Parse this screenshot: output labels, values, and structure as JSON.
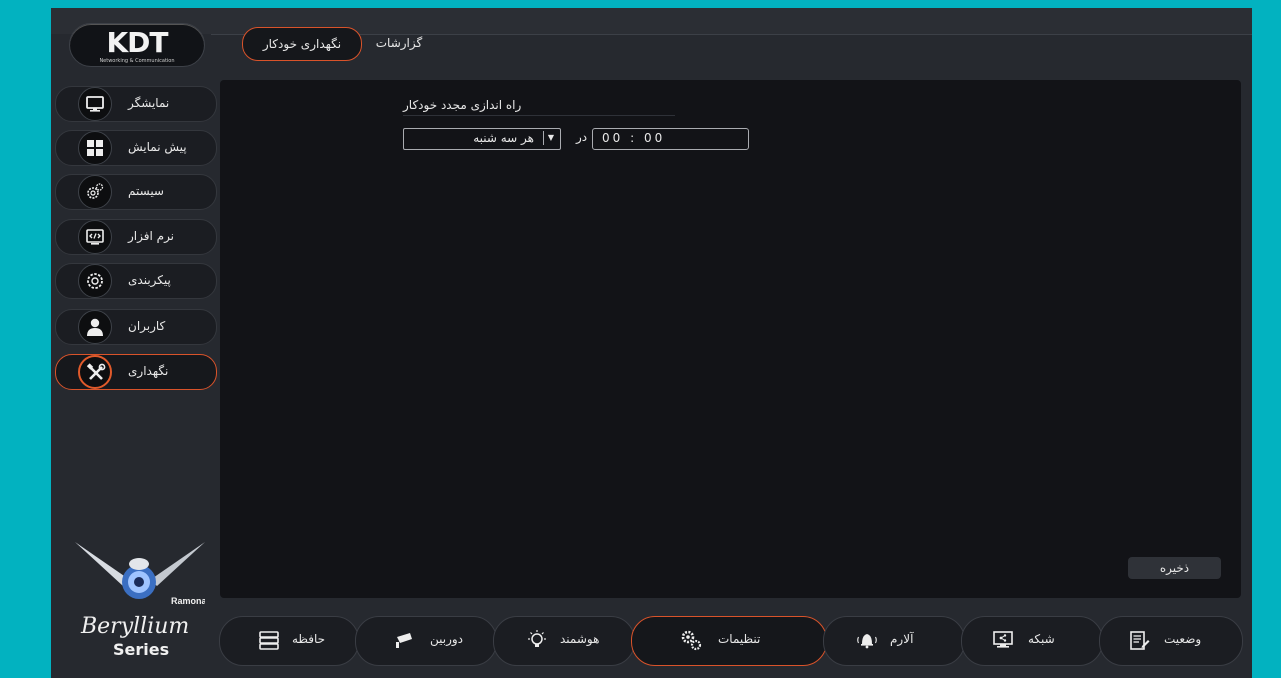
{
  "logo": {
    "mark": "KDT",
    "tagline": "Networking & Communication"
  },
  "top_tabs": {
    "active": "نگهداری خودکار",
    "reports": "گزارشات"
  },
  "sidebar": {
    "items": [
      {
        "label": "نمایشگر",
        "icon": "monitor-icon"
      },
      {
        "label": "پیش نمایش",
        "icon": "grid-icon"
      },
      {
        "label": "سیستم",
        "icon": "gears-icon"
      },
      {
        "label": "نرم افزار",
        "icon": "code-icon"
      },
      {
        "label": "پیکربندی",
        "icon": "config-gear-icon"
      },
      {
        "label": "کاربران",
        "icon": "user-icon"
      },
      {
        "label": "نگهداری",
        "icon": "tools-icon"
      }
    ],
    "active_index": 6
  },
  "main": {
    "section_title": "راه اندازی مجدد خودکار",
    "day_select": {
      "value": "هر سه شنبه"
    },
    "at_label": "در",
    "time_value": "00 : 00",
    "save_label": "ذخیره"
  },
  "brand": {
    "mascot_label": "Ramona",
    "series_name": "Beryllium",
    "series_word": "Series"
  },
  "bottom_nav": [
    {
      "label": "حافظه",
      "icon": "storage-icon"
    },
    {
      "label": "دوربین",
      "icon": "camera-icon"
    },
    {
      "label": "هوشمند",
      "icon": "smart-bulb-icon"
    },
    {
      "label": "تنظیمات",
      "icon": "settings-gears-icon"
    },
    {
      "label": "آلارم",
      "icon": "alarm-bell-icon"
    },
    {
      "label": "شبکه",
      "icon": "network-icon"
    },
    {
      "label": "وضعیت",
      "icon": "status-icon"
    }
  ],
  "colors": {
    "accent": "#d9532a",
    "frame": "#02b2c0",
    "panel": "#121317",
    "background": "#26292f"
  }
}
